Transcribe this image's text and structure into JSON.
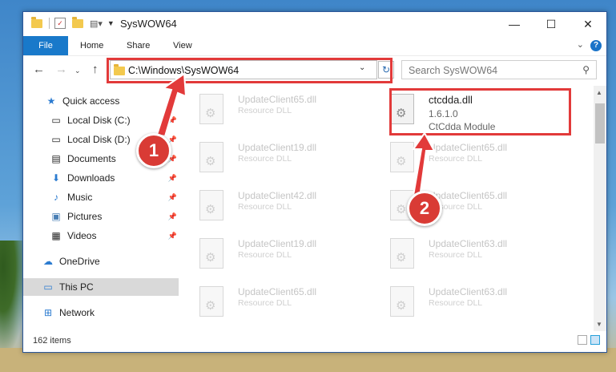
{
  "window": {
    "title": "SysWOW64"
  },
  "ribbon": {
    "tabs": [
      "File",
      "Home",
      "Share",
      "View"
    ]
  },
  "address": {
    "path": "C:\\Windows\\SysWOW64"
  },
  "search": {
    "placeholder": "Search SysWOW64"
  },
  "nav": {
    "quick_access": "Quick access",
    "items": [
      {
        "label": "Local Disk (C:)",
        "pinned": true
      },
      {
        "label": "Local Disk (D:)",
        "pinned": true
      },
      {
        "label": "Documents",
        "pinned": true
      },
      {
        "label": "Downloads",
        "pinned": true
      },
      {
        "label": "Music",
        "pinned": true
      },
      {
        "label": "Pictures",
        "pinned": true
      },
      {
        "label": "Videos",
        "pinned": true
      }
    ],
    "onedrive": "OneDrive",
    "this_pc": "This PC",
    "network": "Network"
  },
  "files": {
    "left": [
      {
        "name": "UpdateClient65.dll",
        "desc": "Resource DLL"
      },
      {
        "name": "UpdateClient19.dll",
        "desc": "Resource DLL"
      },
      {
        "name": "UpdateClient42.dll",
        "desc": "Resource DLL"
      },
      {
        "name": "UpdateClient19.dll",
        "desc": "Resource DLL"
      },
      {
        "name": "UpdateClient65.dll",
        "desc": "Resource DLL"
      }
    ],
    "right": [
      {
        "name": "UpdateClient65.dll",
        "desc": "Resource DLL"
      },
      {
        "name": "UpdateClient65.dll",
        "desc": "Resource DLL"
      },
      {
        "name": "UpdateClient63.dll",
        "desc": "Resource DLL"
      },
      {
        "name": "UpdateClient63.dll",
        "desc": "Resource DLL"
      }
    ],
    "highlighted": {
      "name": "ctcdda.dll",
      "version": "1.6.1.0",
      "description": "CtCdda Module"
    }
  },
  "status": {
    "items": "162 items"
  },
  "annotations": {
    "badge1": "1",
    "badge2": "2",
    "color": "#e23a3a"
  }
}
